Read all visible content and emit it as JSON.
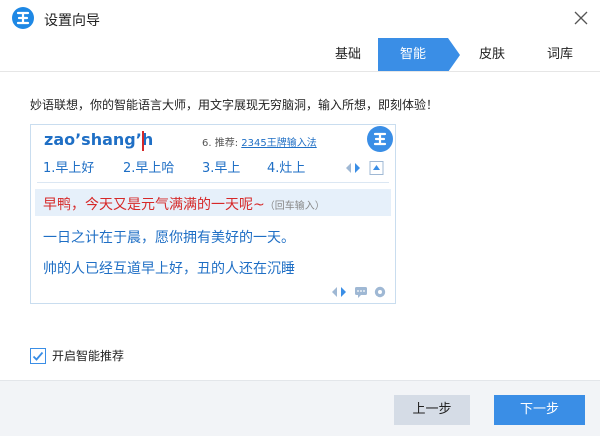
{
  "window": {
    "title": "设置向导"
  },
  "tabs": [
    {
      "label": "基础"
    },
    {
      "label": "智能"
    },
    {
      "label": "皮肤"
    },
    {
      "label": "词库"
    }
  ],
  "description": "妙语联想，你的智能语言大师，用文字展现无穷脑洞，输入所想，即刻体验！",
  "preview": {
    "pinyin": "zao’shang’h",
    "promo_prefix": "6. 推荐:",
    "promo_link": "2345王牌输入法",
    "candidates": [
      "1.早上好",
      "2.早上哈",
      "3.早上",
      "4.灶上"
    ],
    "sentences": [
      {
        "text": "早鸭，今天又是元气满满的一天呢~",
        "tag": "（回车输入）"
      },
      {
        "text": "一日之计在于晨，愿你拥有美好的一天。"
      },
      {
        "text": "帅的人已经互道早上好，丑的人还在沉睡"
      }
    ]
  },
  "option": {
    "label": "开启智能推荐",
    "checked": true
  },
  "footer": {
    "prev_label": "上一步",
    "next_label": "下一步"
  },
  "colors": {
    "accent": "#3a8ee6",
    "text_blue": "#1f6fc5",
    "text_red": "#d62828"
  }
}
